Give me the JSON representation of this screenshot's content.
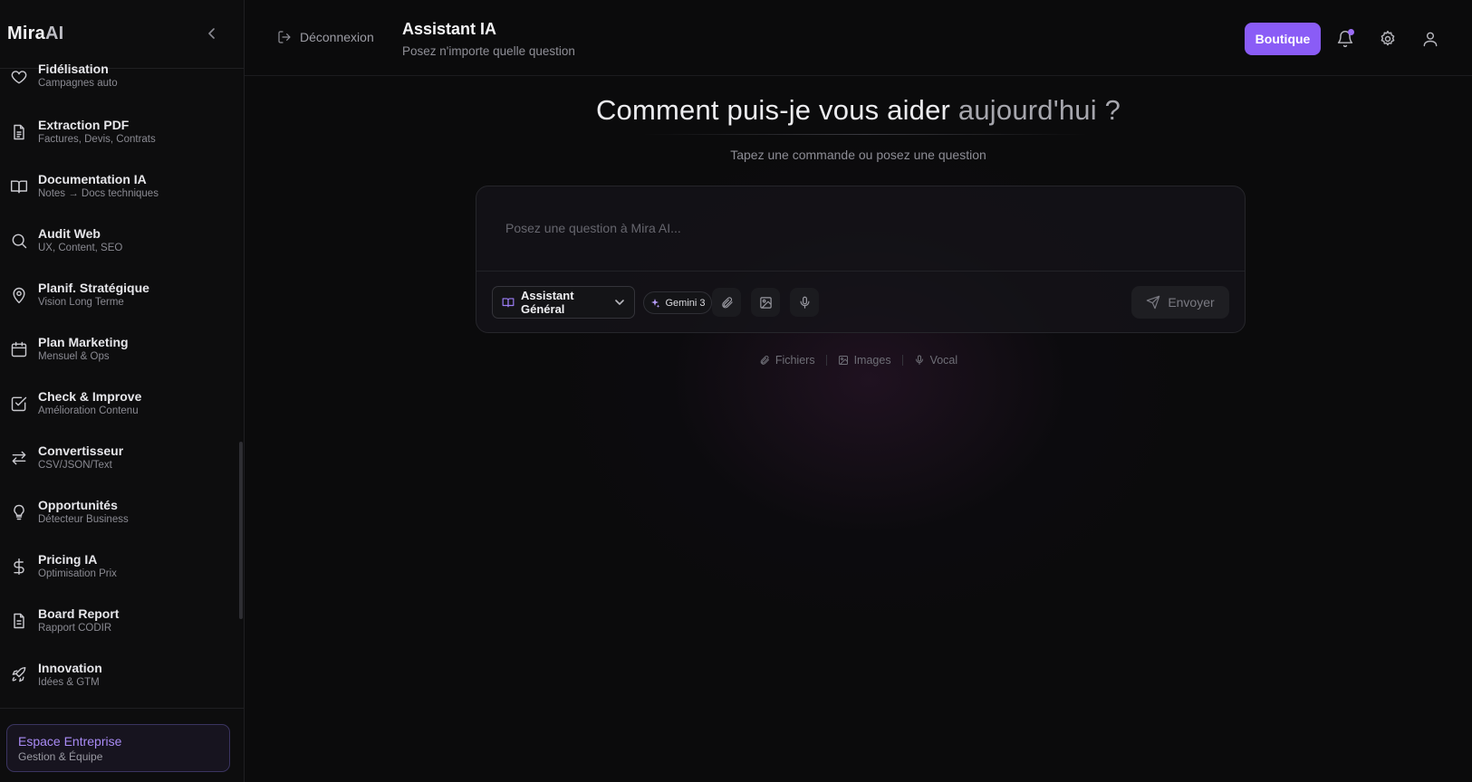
{
  "sidebar": {
    "brand_main": "Mira",
    "brand_ai": "AI",
    "items": [
      {
        "label": "Fidélisation",
        "sub": "Campagnes auto",
        "icon": "heart-icon"
      },
      {
        "label": "Extraction PDF",
        "sub": "Factures, Devis, Contrats",
        "icon": "document-icon"
      },
      {
        "label": "Documentation IA",
        "sub": "Notes → Docs techniques",
        "icon": "book-icon"
      },
      {
        "label": "Audit Web",
        "sub": "UX, Content, SEO",
        "icon": "search-icon"
      },
      {
        "label": "Planif. Stratégique",
        "sub": "Vision Long Terme",
        "icon": "map-pin-icon"
      },
      {
        "label": "Plan Marketing",
        "sub": "Mensuel & Ops",
        "icon": "calendar-icon"
      },
      {
        "label": "Check & Improve",
        "sub": "Amélioration Contenu",
        "icon": "checkbox-icon"
      },
      {
        "label": "Convertisseur",
        "sub": "CSV/JSON/Text",
        "icon": "arrows-icon"
      },
      {
        "label": "Opportunités",
        "sub": "Détecteur Business",
        "icon": "lightbulb-icon"
      },
      {
        "label": "Pricing IA",
        "sub": "Optimisation Prix",
        "icon": "dollar-icon"
      },
      {
        "label": "Board Report",
        "sub": "Rapport CODIR",
        "icon": "report-icon"
      },
      {
        "label": "Innovation",
        "sub": "Idées & GTM",
        "icon": "rocket-icon"
      }
    ],
    "footer": {
      "title": "Espace Entreprise",
      "sub": "Gestion & Équipe"
    }
  },
  "header": {
    "logout_label": "Déconnexion",
    "title": "Assistant IA",
    "subtitle": "Posez n'importe quelle question",
    "shop_label": "Boutique"
  },
  "hero": {
    "title_main": "Comment puis-je vous aider ",
    "title_fade": "aujourd'hui ?",
    "subtitle": "Tapez une commande ou posez une question"
  },
  "composer": {
    "placeholder": "Posez une question à Mira AI...",
    "mode_label": "Assistant Général",
    "model_label": "Gemini 3",
    "send_label": "Envoyer"
  },
  "hints": [
    {
      "label": "Fichiers",
      "icon": "paperclip-icon"
    },
    {
      "label": "Images",
      "icon": "image-icon"
    },
    {
      "label": "Vocal",
      "icon": "microphone-icon"
    }
  ],
  "colors": {
    "accent": "#8a5cf6",
    "background": "#0b0b0c"
  }
}
